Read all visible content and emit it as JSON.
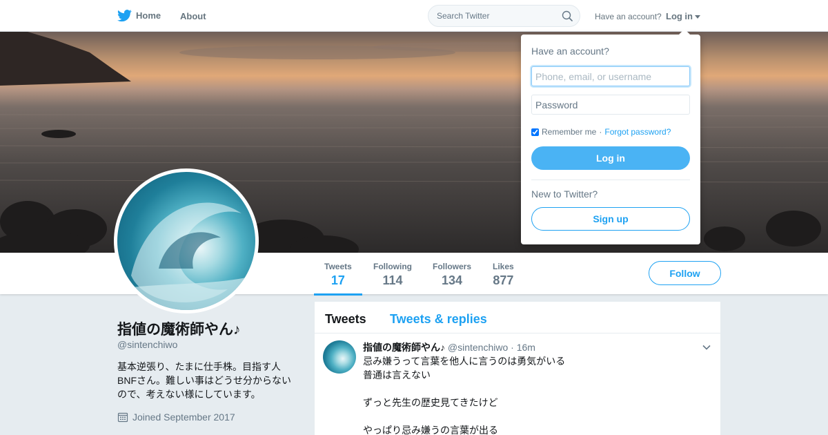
{
  "nav": {
    "home_label": "Home",
    "about_label": "About",
    "search_placeholder": "Search Twitter",
    "have_account_text": "Have an account?",
    "login_label": "Log in"
  },
  "profile_nav": {
    "stats": [
      {
        "label": "Tweets",
        "value": "17"
      },
      {
        "label": "Following",
        "value": "114"
      },
      {
        "label": "Followers",
        "value": "134"
      },
      {
        "label": "Likes",
        "value": "877"
      }
    ],
    "follow_label": "Follow"
  },
  "profile": {
    "name": "指値の魔術師やん♪",
    "handle": "@sintenchiwo",
    "bio_lines": [
      "基本逆張り、たまに仕手株。目指す人",
      "BNFさん。難しい事はどうせ分からない",
      "ので、考えない様にしています。"
    ],
    "joined": "Joined September 2017"
  },
  "timeline": {
    "tabs": [
      "Tweets",
      "Tweets & replies"
    ],
    "tweet": {
      "name": "指値の魔術師やん♪",
      "handle": "@sintenchiwo",
      "time": "16m",
      "text": "忌み嫌うって言葉を他人に言うのは勇気がいる\n普通は言えない\n\nずっと先生の歴史見てきたけど\n\nやっぱり忌み嫌うの言葉が出る"
    }
  },
  "login_dropdown": {
    "title": "Have an account?",
    "username_placeholder": "Phone, email, or username",
    "password_placeholder": "Password",
    "remember_label": "Remember me",
    "separator": "·",
    "forgot_label": "Forgot password?",
    "login_button": "Log in",
    "new_text": "New to Twitter?",
    "signup_button": "Sign up"
  },
  "colors": {
    "accent": "#1da1f2",
    "background": "#e6ecf0",
    "muted_text": "#657786"
  },
  "icons": [
    "twitter-bird-icon",
    "search-icon",
    "caret-down-icon",
    "calendar-icon",
    "chevron-down-icon",
    "checkbox-icon"
  ]
}
